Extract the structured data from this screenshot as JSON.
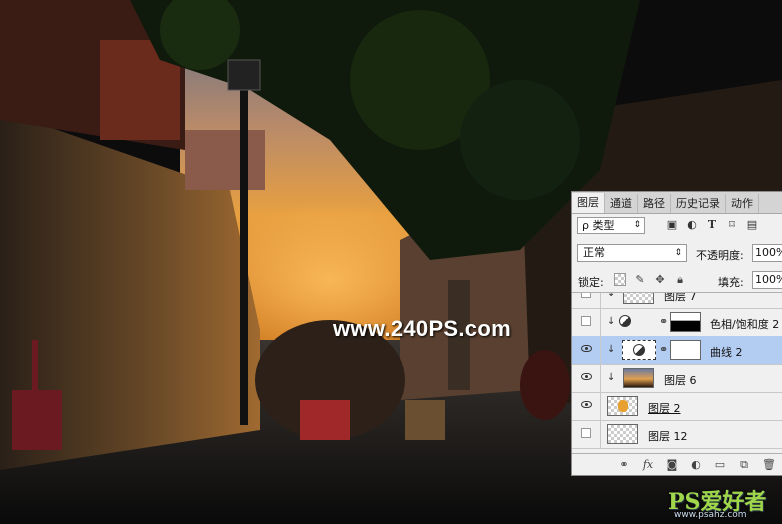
{
  "watermark": "www.240PS.com",
  "logo": {
    "big": "PS爱好者",
    "small": "www.psahz.com"
  },
  "panel": {
    "tabs": [
      "图层",
      "通道",
      "路径",
      "历史记录",
      "动作"
    ],
    "filter": {
      "label": "ρ 类型",
      "arrow": "⇕"
    },
    "filter_icons": [
      "image-filter-icon",
      "adjustment-filter-icon",
      "type-filter-icon",
      "shape-filter-icon",
      "smartobject-filter-icon"
    ],
    "blend_mode": "正常",
    "opacity_label": "不透明度:",
    "opacity_value": "100%",
    "lock_label": "锁定:",
    "fill_label": "填充:",
    "fill_value": "100%",
    "layers": [
      {
        "name": "图层 7",
        "visible": false,
        "clipped": true,
        "type": "pixel",
        "selected": false
      },
      {
        "name": "色相/饱和度 2",
        "visible": false,
        "clipped": true,
        "type": "adjustment",
        "selected": false
      },
      {
        "name": "曲线 2",
        "visible": true,
        "clipped": true,
        "type": "adjustment",
        "selected": true
      },
      {
        "name": "图层 6",
        "visible": true,
        "clipped": true,
        "type": "photo",
        "selected": false
      },
      {
        "name": "图层 2",
        "visible": true,
        "clipped": false,
        "type": "pixel",
        "selected": false
      },
      {
        "name": "图层 12",
        "visible": false,
        "clipped": false,
        "type": "pixel",
        "selected": false
      }
    ],
    "footer_icons": [
      "link-icon",
      "fx-icon",
      "mask-icon",
      "adjustment-icon",
      "folder-icon",
      "new-layer-icon",
      "trash-icon"
    ]
  }
}
